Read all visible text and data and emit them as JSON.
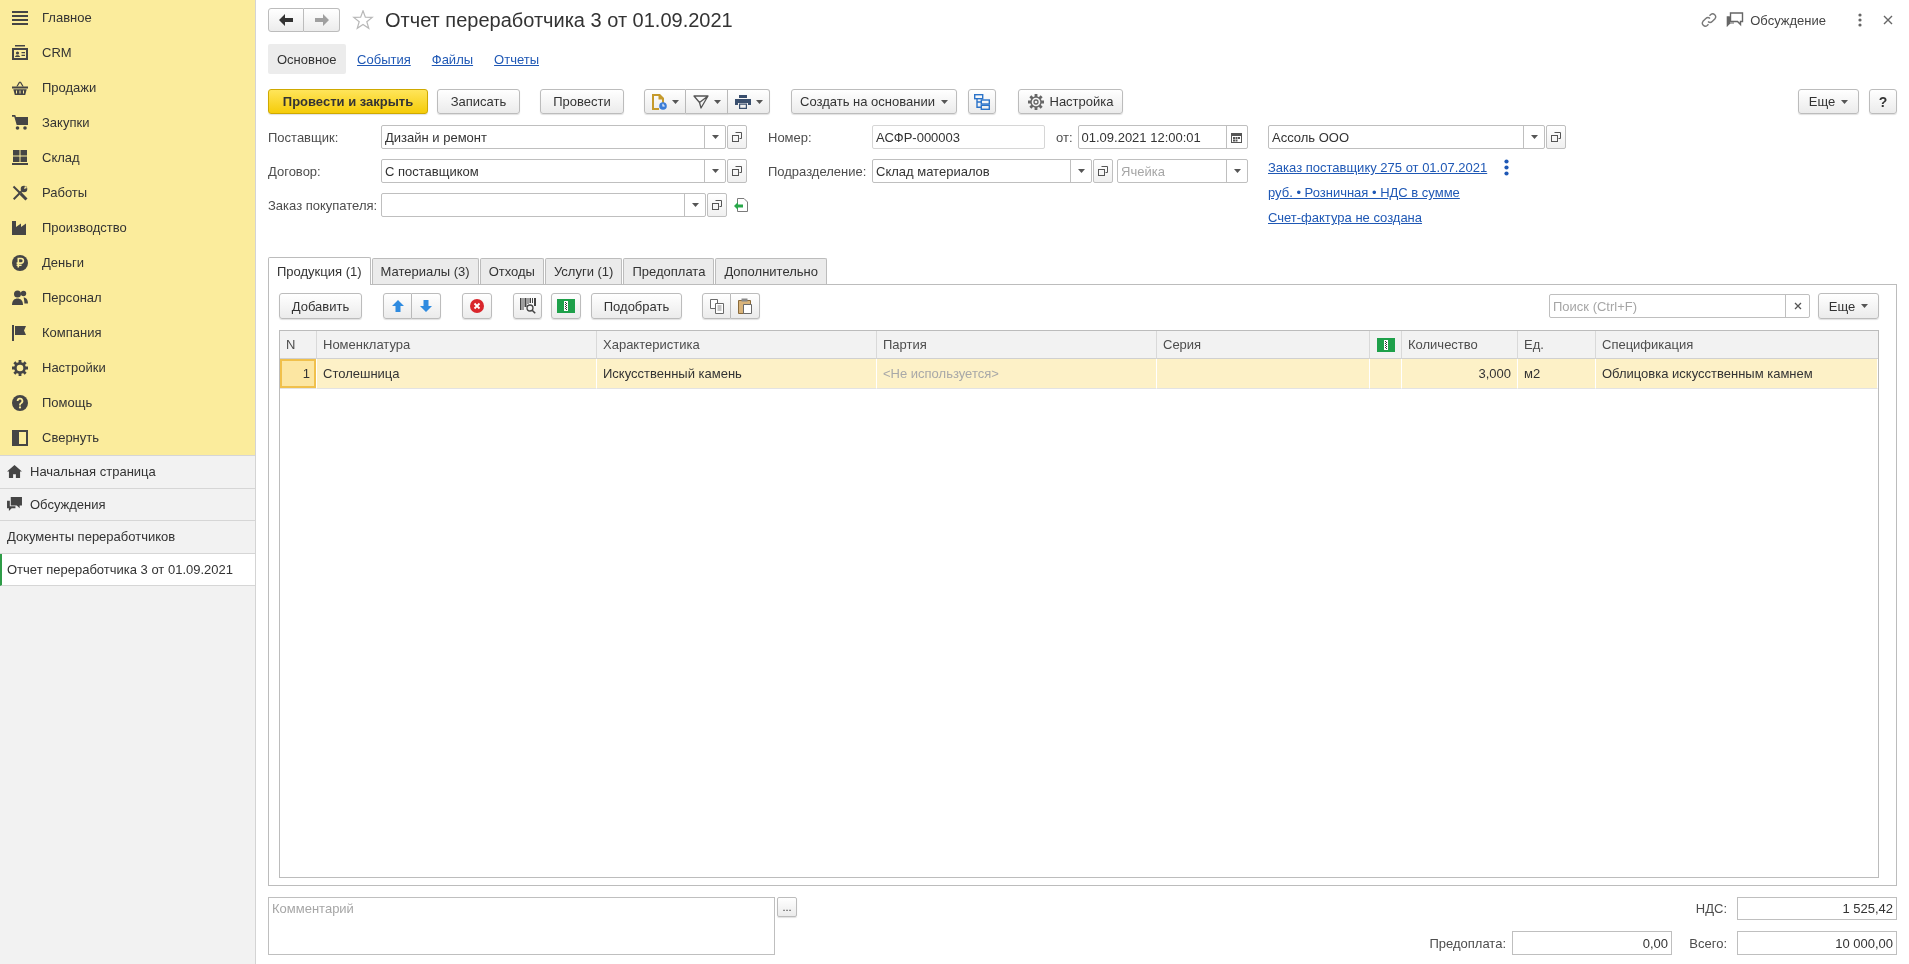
{
  "sidebar": {
    "sections": [
      {
        "label": "Главное",
        "selected": false
      },
      {
        "label": "CRM",
        "selected": false
      },
      {
        "label": "Продажи",
        "selected": false
      },
      {
        "label": "Закупки",
        "selected": false
      },
      {
        "label": "Склад",
        "selected": false
      },
      {
        "label": "Работы",
        "selected": false
      },
      {
        "label": "Производство",
        "selected": false
      },
      {
        "label": "Деньги",
        "selected": false
      },
      {
        "label": "Персонал",
        "selected": false
      },
      {
        "label": "Компания",
        "selected": false
      },
      {
        "label": "Настройки",
        "selected": false
      },
      {
        "label": "Помощь",
        "selected": false
      },
      {
        "label": "Свернуть",
        "selected": false
      }
    ],
    "windows": [
      {
        "label": "Начальная страница",
        "selected": false
      },
      {
        "label": "Обсуждения",
        "selected": false
      },
      {
        "label": "Документы переработчиков",
        "selected": false
      },
      {
        "label": "Отчет переработчика 3 от 01.09.2021",
        "selected": true
      }
    ]
  },
  "header": {
    "title": "Отчет переработчика 3 от 01.09.2021",
    "favorite": false,
    "discussion": "Обсуждение"
  },
  "form_tabs": [
    {
      "label": "Основное",
      "selected": true
    },
    {
      "label": "События",
      "selected": false
    },
    {
      "label": "Файлы",
      "selected": false
    },
    {
      "label": "Отчеты",
      "selected": false
    }
  ],
  "command_bar": {
    "post_and_close": "Провести и закрыть",
    "save": "Записать",
    "post": "Провести",
    "create_based_on": "Создать на основании",
    "settings": "Настройка",
    "more": "Еще",
    "help": "?"
  },
  "fields": {
    "supplier": {
      "label": "Поставщик:",
      "value": "Дизайн и ремонт"
    },
    "contract": {
      "label": "Договор:",
      "value": "С поставщиком"
    },
    "customer_order": {
      "label": "Заказ покупателя:"
    },
    "number": {
      "label": "Номер:",
      "value": "АСФР-000003"
    },
    "date": {
      "label": "от:",
      "value": "01.09.2021 12:00:01"
    },
    "department": {
      "label": "Подразделение:",
      "value": "Склад материалов"
    },
    "storage_cell": {
      "placeholder": "Ячейка"
    },
    "organization": {
      "value": "Ассоль ООО"
    }
  },
  "links": [
    "Заказ поставщику 275 от 01.07.2021",
    "руб. • Розничная • НДС в сумме",
    "Счет-фактура не создана"
  ],
  "tabs": [
    {
      "label": "Продукция (1)",
      "selected": true
    },
    {
      "label": "Материалы (3)",
      "selected": false
    },
    {
      "label": "Отходы",
      "selected": false
    },
    {
      "label": "Услуги (1)",
      "selected": false
    },
    {
      "label": "Предоплата",
      "selected": false
    },
    {
      "label": "Дополнительно",
      "selected": false
    }
  ],
  "table_bar": {
    "add": "Добавить",
    "pick": "Подобрать",
    "search": {
      "placeholder": "Поиск (Ctrl+F)"
    },
    "more": "Еще"
  },
  "table": {
    "columns": [
      {
        "kind": "number",
        "label": "N"
      },
      {
        "kind": "text",
        "label": "Номенклатура"
      },
      {
        "kind": "text",
        "label": "Характеристика"
      },
      {
        "kind": "text",
        "label": "Партия"
      },
      {
        "kind": "text",
        "label": "Серия"
      },
      {
        "kind": "icon"
      },
      {
        "kind": "number",
        "label": "Количество"
      },
      {
        "kind": "text",
        "label": "Ед."
      },
      {
        "kind": "text",
        "label": "Спецификация"
      }
    ],
    "rows": [
      {
        "selected": true,
        "cells": [
          {
            "text": "1",
            "focused": true,
            "disabled": false
          },
          {
            "text": "Столешница",
            "focused": false,
            "disabled": false
          },
          {
            "text": "Искусственный камень",
            "focused": false,
            "disabled": false
          },
          {
            "text": "<Не используется>",
            "focused": false,
            "disabled": true
          },
          null,
          null,
          {
            "text": "3,000",
            "focused": false,
            "disabled": false
          },
          {
            "text": "м2",
            "focused": false,
            "disabled": false
          },
          {
            "text": "Облицовка искусственным камнем",
            "focused": false,
            "disabled": false
          }
        ]
      }
    ]
  },
  "comment": {
    "placeholder": "Комментарий",
    "button": "..."
  },
  "totals": {
    "vat": {
      "label": "НДС:",
      "value": "1 525,42"
    },
    "prepayment": {
      "label": "Предоплата:",
      "value": "0,00"
    },
    "total": {
      "label": "Всего:",
      "value": "10 000,00"
    }
  }
}
